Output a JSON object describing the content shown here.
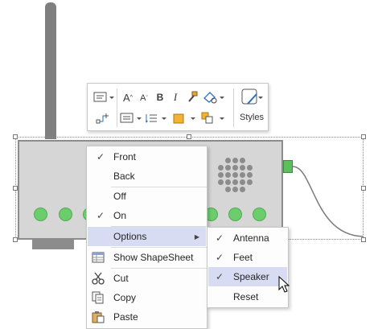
{
  "toolbar": {
    "styles_label": "Styles",
    "buttons": {
      "grow_font": "A",
      "shrink_font": "A",
      "bold": "B",
      "italic": "I"
    }
  },
  "context_menu": {
    "items": [
      {
        "label": "Front",
        "checked": true
      },
      {
        "label": "Back",
        "checked": false
      },
      {
        "label": "Off",
        "checked": false
      },
      {
        "label": "On",
        "checked": true
      },
      {
        "label": "Options",
        "has_submenu": true,
        "highlighted": true
      },
      {
        "label": "Show ShapeSheet",
        "icon": "shapesheet-icon"
      },
      {
        "label": "Cut",
        "icon": "scissors-icon"
      },
      {
        "label": "Copy",
        "icon": "copy-icon"
      },
      {
        "label": "Paste",
        "icon": "paste-icon"
      }
    ]
  },
  "submenu": {
    "items": [
      {
        "label": "Antenna",
        "checked": true
      },
      {
        "label": "Feet",
        "checked": true
      },
      {
        "label": "Speaker",
        "checked": true,
        "highlighted": true
      },
      {
        "label": "Reset",
        "checked": false
      }
    ]
  },
  "check_glyph": "✓",
  "submenu_arrow": "▶",
  "colors": {
    "highlight": "#d7dcf3",
    "led_green": "#6ccd6c",
    "shape_gray": "#d6d6d6"
  }
}
